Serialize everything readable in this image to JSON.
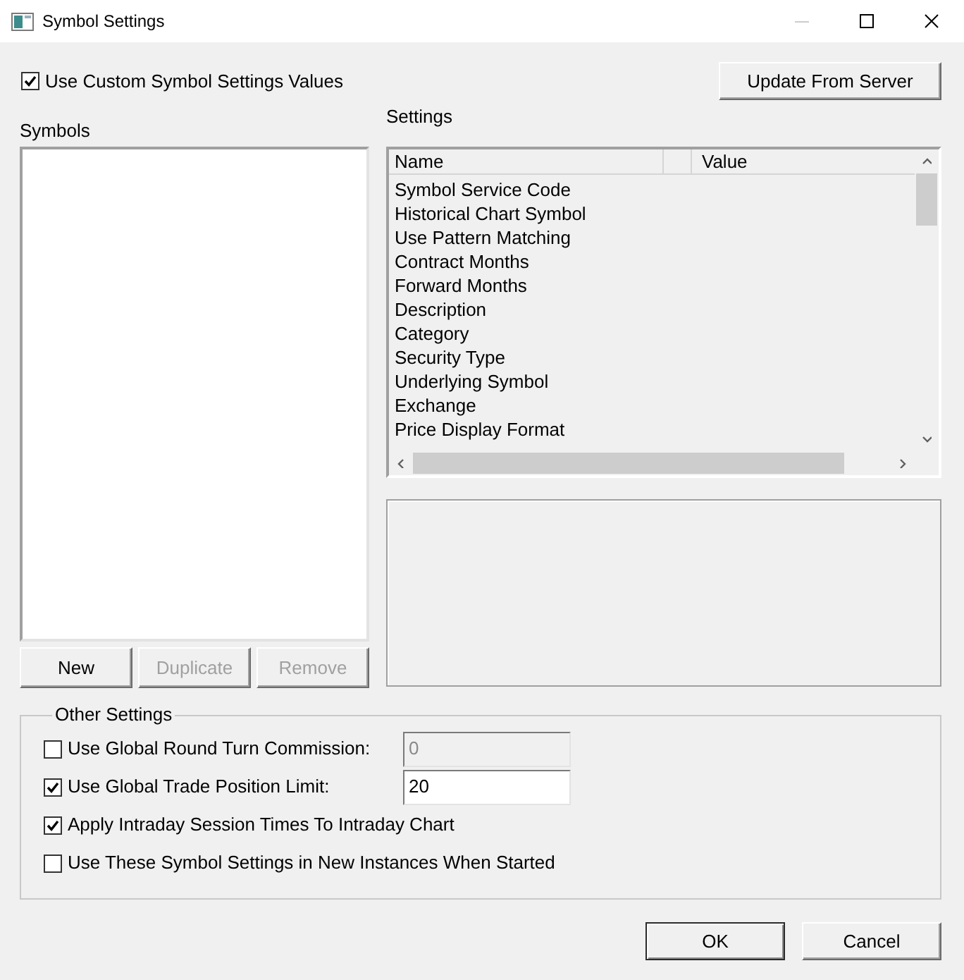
{
  "window": {
    "title": "Symbol Settings",
    "minimize_disabled": true
  },
  "custom_values": {
    "label": "Use Custom Symbol Settings Values",
    "checked": true
  },
  "update_button": {
    "label": "Update From Server"
  },
  "symbols": {
    "label": "Symbols",
    "buttons": [
      {
        "label": "New",
        "disabled": false
      },
      {
        "label": "Duplicate",
        "disabled": true
      },
      {
        "label": "Remove",
        "disabled": true
      }
    ]
  },
  "settings": {
    "label": "Settings",
    "columns": [
      "Name",
      "Value"
    ],
    "rows": [
      "Symbol Service Code",
      "Historical Chart Symbol",
      "Use Pattern Matching",
      "Contract Months",
      "Forward Months",
      "Description",
      "Category",
      "Security Type",
      "Underlying Symbol",
      "Exchange",
      "Price Display Format"
    ]
  },
  "other_settings": {
    "title": "Other Settings",
    "options": [
      {
        "label": "Use Global Round Turn Commission:",
        "checked": false,
        "field": {
          "value": "0",
          "disabled": true
        }
      },
      {
        "label": "Use Global Trade Position Limit:",
        "checked": true,
        "field": {
          "value": "20",
          "disabled": false
        }
      },
      {
        "label": "Apply Intraday Session Times To Intraday Chart",
        "checked": true
      },
      {
        "label": "Use These Symbol Settings in New Instances When Started",
        "checked": false
      }
    ]
  },
  "dialog_buttons": [
    {
      "label": "OK",
      "default": true
    },
    {
      "label": "Cancel",
      "default": false
    }
  ]
}
